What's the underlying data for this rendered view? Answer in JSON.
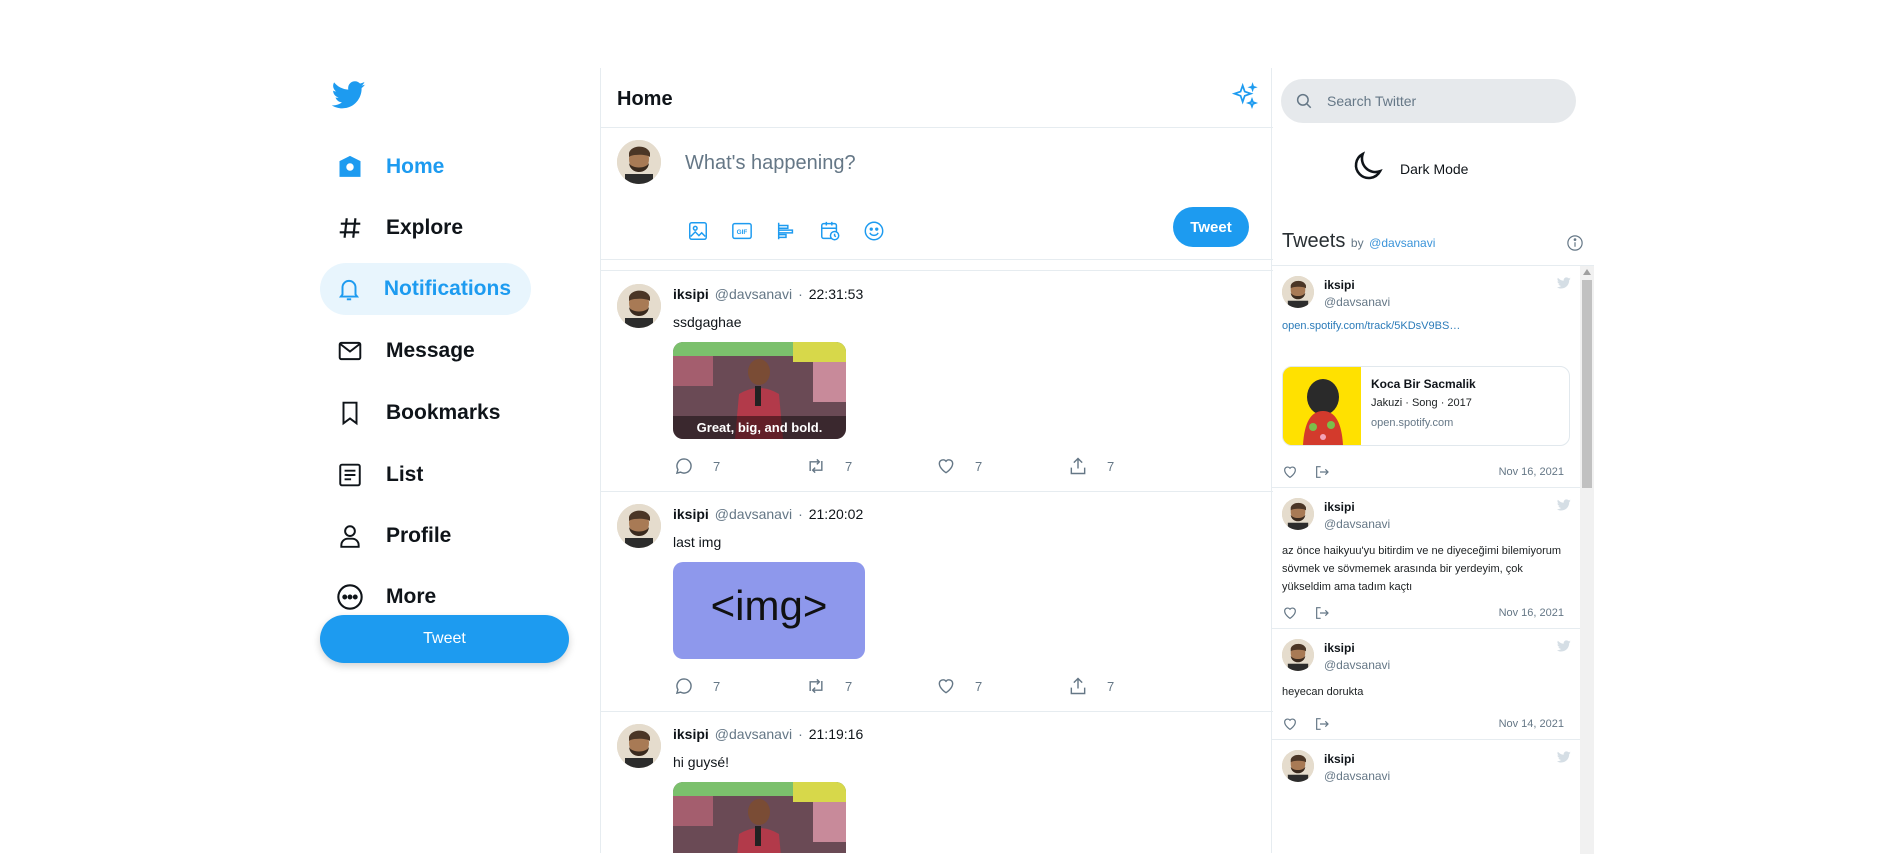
{
  "colors": {
    "accent": "#1d9bf0",
    "text": "#0f1419",
    "muted": "#657786",
    "border": "#e6ecf0"
  },
  "nav": {
    "items": [
      {
        "label": "Home",
        "icon": "home-icon",
        "state": "active"
      },
      {
        "label": "Explore",
        "icon": "hashtag-icon",
        "state": "normal"
      },
      {
        "label": "Notifications",
        "icon": "bell-icon",
        "state": "selected"
      },
      {
        "label": "Message",
        "icon": "mail-icon",
        "state": "normal"
      },
      {
        "label": "Bookmarks",
        "icon": "bookmark-icon",
        "state": "normal"
      },
      {
        "label": "List",
        "icon": "list-icon",
        "state": "normal"
      },
      {
        "label": "Profile",
        "icon": "user-icon",
        "state": "normal"
      },
      {
        "label": "More",
        "icon": "more-icon",
        "state": "normal"
      }
    ],
    "tweet_button": "Tweet"
  },
  "header": {
    "title": "Home"
  },
  "compose": {
    "placeholder": "What's happening?",
    "tweet_button": "Tweet",
    "icons": [
      "image-icon",
      "gif-icon",
      "poll-icon",
      "schedule-icon",
      "emoji-icon"
    ]
  },
  "feed": [
    {
      "name": "iksipi",
      "handle": "@davsanavi",
      "time": "22:31:53",
      "text": "ssdgaghae",
      "media_caption": "Great, big, and bold.",
      "replies": "7",
      "retweets": "7",
      "likes": "7",
      "shares": "7"
    },
    {
      "name": "iksipi",
      "handle": "@davsanavi",
      "time": "21:20:02",
      "text": "last img",
      "media_caption": "<img>",
      "replies": "7",
      "retweets": "7",
      "likes": "7",
      "shares": "7"
    },
    {
      "name": "iksipi",
      "handle": "@davsanavi",
      "time": "21:19:16",
      "text": "hi guysé!",
      "media_caption": ""
    }
  ],
  "search": {
    "placeholder": "Search Twitter"
  },
  "dark_mode": {
    "label": "Dark Mode"
  },
  "timeline": {
    "title": "Tweets",
    "by": "by",
    "by_handle": "@davsanavi",
    "tweets": [
      {
        "name": "iksipi",
        "handle": "@davsanavi",
        "link": "open.spotify.com/track/5KDsV9BS…",
        "card": {
          "title": "Koca Bir Sacmalik",
          "subtitle": "Jakuzi · Song · 2017",
          "domain": "open.spotify.com"
        },
        "date": "Nov 16, 2021"
      },
      {
        "name": "iksipi",
        "handle": "@davsanavi",
        "text": "az önce haikyuu'yu bitirdim ve ne diyeceğimi bilemiyorum sövmek ve sövmemek arasında bir yerdeyim, çok yükseldim ama tadım kaçtı",
        "date": "Nov 16, 2021"
      },
      {
        "name": "iksipi",
        "handle": "@davsanavi",
        "text": "heyecan dorukta",
        "date": "Nov 14, 2021"
      },
      {
        "name": "iksipi",
        "handle": "@davsanavi"
      }
    ]
  }
}
